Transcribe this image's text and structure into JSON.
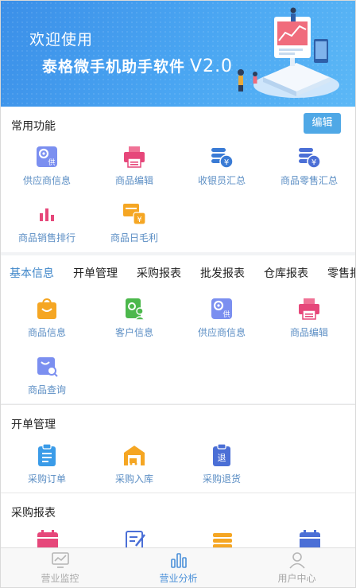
{
  "banner": {
    "welcome": "欢迎使用",
    "product": "泰格微手机助手软件",
    "version": "V2.0"
  },
  "common": {
    "title": "常用功能",
    "edit_label": "编辑",
    "items": [
      {
        "label": "供应商信息",
        "icon": "supplier-icon"
      },
      {
        "label": "商品编辑",
        "icon": "printer-icon"
      },
      {
        "label": "收银员汇总",
        "icon": "coin-stack-icon"
      },
      {
        "label": "商品零售汇总",
        "icon": "coin-stack-icon"
      },
      {
        "label": "商品销售排行",
        "icon": "bar-chart-icon"
      },
      {
        "label": "商品日毛利",
        "icon": "money-box-icon"
      }
    ]
  },
  "tabs": [
    {
      "label": "基本信息",
      "active": true
    },
    {
      "label": "开单管理",
      "active": false
    },
    {
      "label": "采购报表",
      "active": false
    },
    {
      "label": "批发报表",
      "active": false
    },
    {
      "label": "仓库报表",
      "active": false
    },
    {
      "label": "零售报",
      "active": false
    }
  ],
  "basic": {
    "items": [
      {
        "label": "商品信息",
        "icon": "shopping-bag-icon"
      },
      {
        "label": "客户信息",
        "icon": "customer-icon"
      },
      {
        "label": "供应商信息",
        "icon": "supplier-icon"
      },
      {
        "label": "商品编辑",
        "icon": "printer-icon"
      },
      {
        "label": "商品查询",
        "icon": "search-bag-icon"
      }
    ]
  },
  "orders": {
    "title": "开单管理",
    "items": [
      {
        "label": "采购订单",
        "icon": "clipboard-icon"
      },
      {
        "label": "采购入库",
        "icon": "warehouse-icon"
      },
      {
        "label": "采购退货",
        "icon": "return-icon"
      }
    ],
    "return_glyph": "退"
  },
  "purchase_report": {
    "title": "采购报表"
  },
  "bottom_nav": [
    {
      "label": "营业监控",
      "icon": "monitor-icon",
      "active": false
    },
    {
      "label": "营业分析",
      "icon": "analysis-icon",
      "active": true
    },
    {
      "label": "用户中心",
      "icon": "user-icon",
      "active": false
    }
  ],
  "colors": {
    "accent": "#4fa8e6",
    "label_blue": "#5b8ec4",
    "tab_active": "#3f86c9",
    "banner": "#3b8fe8"
  },
  "supplier_glyph": "供",
  "yen_glyph": "¥"
}
